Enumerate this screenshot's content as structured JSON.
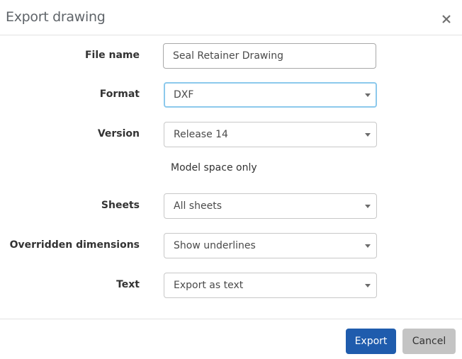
{
  "dialog": {
    "title": "Export drawing",
    "close_icon": "close-icon"
  },
  "form": {
    "file_name": {
      "label": "File name",
      "value": "Seal Retainer Drawing"
    },
    "format": {
      "label": "Format",
      "value": "DXF"
    },
    "version": {
      "label": "Version",
      "value": "Release 14"
    },
    "model_space_note": "Model space only",
    "sheets": {
      "label": "Sheets",
      "value": "All sheets"
    },
    "overridden_dimensions": {
      "label": "Overridden dimensions",
      "value": "Show underlines"
    },
    "text": {
      "label": "Text",
      "value": "Export as text"
    }
  },
  "footer": {
    "export_label": "Export",
    "cancel_label": "Cancel"
  },
  "colors": {
    "primary": "#1f5cad",
    "focus_border": "#8cc9ec",
    "secondary_button": "#c4c4c4"
  }
}
